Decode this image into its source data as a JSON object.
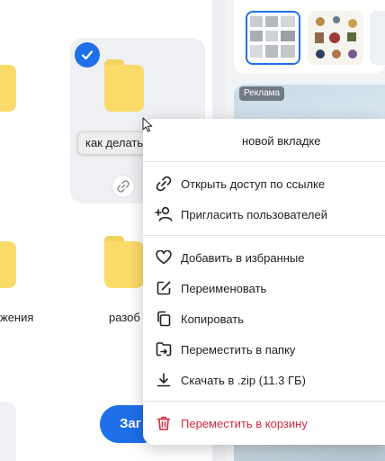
{
  "tooltip": {
    "text": "как делать фото на телефон"
  },
  "folders": {
    "label_left_partial": "жения",
    "label_mid_partial": "разоб"
  },
  "upload_button": {
    "label_partial": "Заг"
  },
  "ad": {
    "label": "Реклама"
  },
  "menu": {
    "items": [
      {
        "label": "новой вкладке",
        "icon": "open-new-tab-icon"
      },
      {
        "label": "Открыть доступ по ссылке",
        "icon": "link-icon"
      },
      {
        "label": "Пригласить пользователей",
        "icon": "add-user-icon"
      },
      {
        "label": "Добавить в избранные",
        "icon": "heart-icon"
      },
      {
        "label": "Переименовать",
        "icon": "edit-icon"
      },
      {
        "label": "Копировать",
        "icon": "copy-icon"
      },
      {
        "label": "Переместить в папку",
        "icon": "move-to-folder-icon"
      },
      {
        "label": "Скачать в .zip (11.3 ГБ)",
        "icon": "download-icon"
      },
      {
        "label": "Переместить в корзину",
        "icon": "trash-icon"
      }
    ]
  },
  "colors": {
    "accent": "#1e6fe8",
    "folder": "#fadb6a",
    "danger": "#d7263d"
  }
}
